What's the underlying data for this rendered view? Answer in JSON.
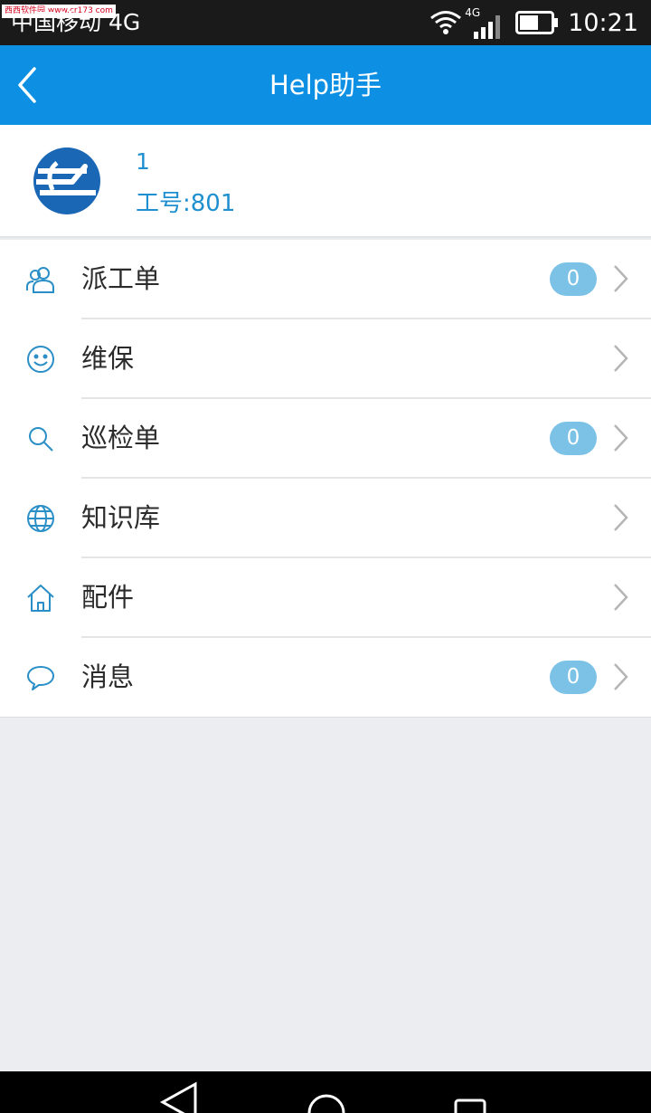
{
  "status_bar": {
    "watermark": "西西软件园 www.cr173.com",
    "carrier": "中国移动 4G",
    "network_label": "4G",
    "time": "10:21"
  },
  "app_bar": {
    "title": "Help助手",
    "back_icon": "chevron-left-icon"
  },
  "profile": {
    "name": "1",
    "employee_id": "工号:801"
  },
  "menu": {
    "items": [
      {
        "label": "派工单",
        "icon": "people-icon",
        "badge": "0"
      },
      {
        "label": "维保",
        "icon": "smile-icon",
        "badge": null
      },
      {
        "label": "巡检单",
        "icon": "search-icon",
        "badge": "0"
      },
      {
        "label": "知识库",
        "icon": "globe-icon",
        "badge": null
      },
      {
        "label": "配件",
        "icon": "home-icon",
        "badge": null
      },
      {
        "label": "消息",
        "icon": "chat-bubble-icon",
        "badge": "0"
      }
    ]
  },
  "colors": {
    "primary": "#0d8fe4",
    "accent_text": "#1e8fcf",
    "badge": "#7cc2e6",
    "icon": "#2a8fc6",
    "background": "#ebedf0"
  }
}
